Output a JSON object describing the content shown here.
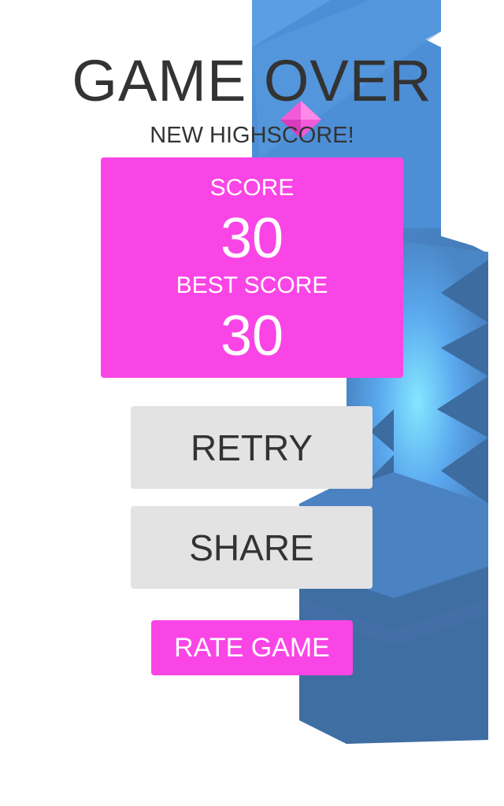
{
  "game": {
    "title": "GAME OVER",
    "subtitle": "NEW HIGHSCORE!",
    "score_label": "SCORE",
    "score_value": "30",
    "best_label": "BEST SCORE",
    "best_value": "30"
  },
  "buttons": {
    "retry": "RETRY",
    "share": "SHARE",
    "rate": "RATE GAME"
  },
  "colors": {
    "accent": "#fa45e6",
    "button_bg": "#e3e3e3",
    "text_dark": "#333333",
    "track_dark": "#3f6ea3",
    "track_light": "#5aa4ec",
    "gem": "#f25ad8"
  }
}
